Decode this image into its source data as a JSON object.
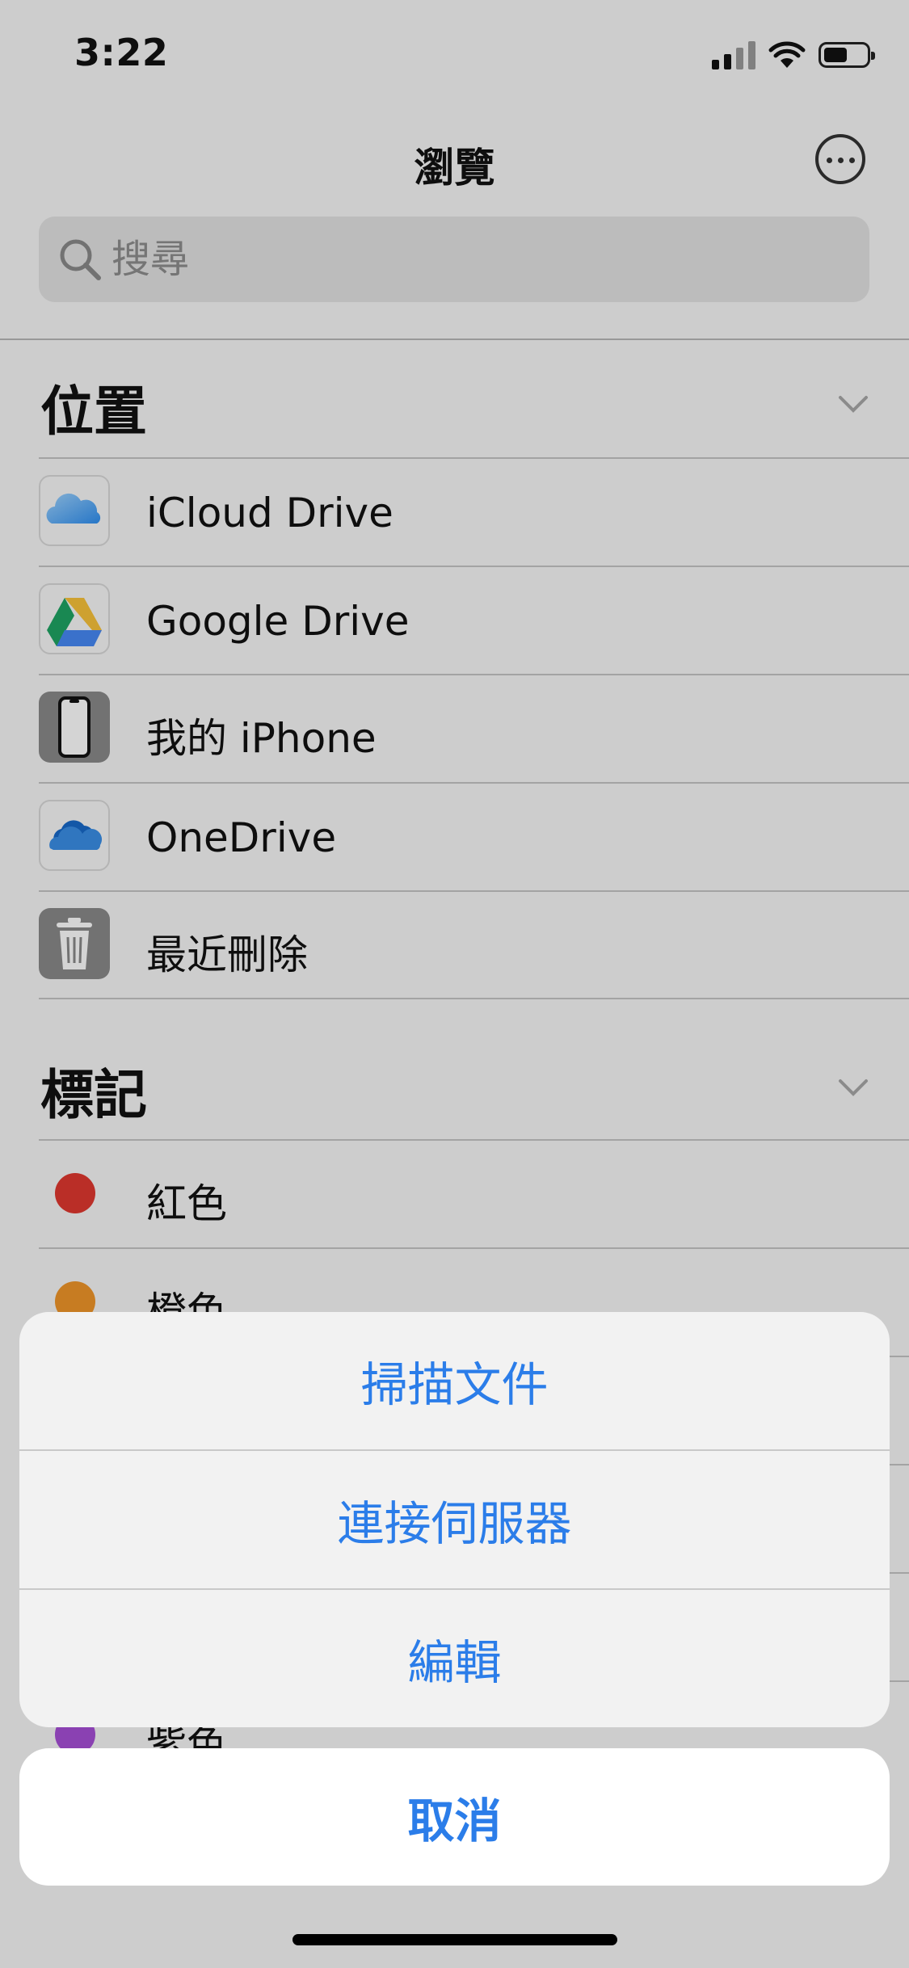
{
  "status_bar": {
    "time": "3:22",
    "battery_level": 0.5
  },
  "header": {
    "title": "瀏覽",
    "more_icon": "ellipsis-circle-icon"
  },
  "search": {
    "placeholder": "搜尋",
    "icon": "search-icon"
  },
  "locations": {
    "title": "位置",
    "items": [
      {
        "label": "iCloud Drive",
        "icon": "icloud-icon"
      },
      {
        "label": "Google Drive",
        "icon": "google-drive-icon"
      },
      {
        "label": "我的 iPhone",
        "icon": "iphone-icon"
      },
      {
        "label": "OneDrive",
        "icon": "onedrive-icon"
      },
      {
        "label": "最近刪除",
        "icon": "trash-icon"
      }
    ]
  },
  "tags": {
    "title": "標記",
    "items": [
      {
        "label": "紅色",
        "color": "#e0382f"
      },
      {
        "label": "橙色",
        "color": "#f0962a"
      },
      {
        "label": "紫色",
        "color": "#a64fd6"
      }
    ]
  },
  "action_sheet": {
    "items": [
      {
        "label": "掃描文件"
      },
      {
        "label": "連接伺服器"
      },
      {
        "label": "編輯"
      }
    ],
    "cancel": "取消"
  },
  "colors": {
    "accent": "#2b7de9"
  }
}
